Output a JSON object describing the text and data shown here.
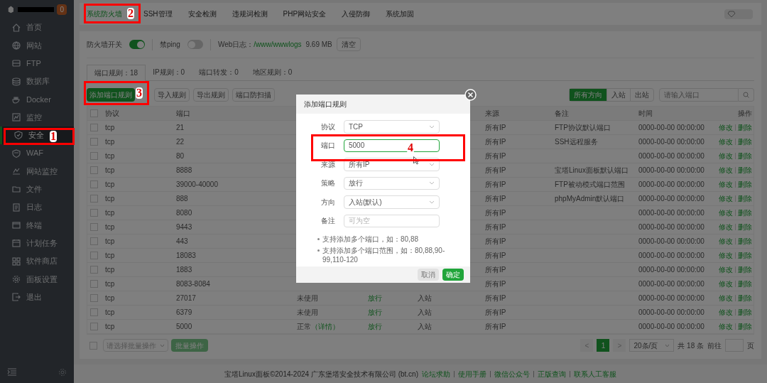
{
  "sidebar": {
    "badge": "0",
    "items": [
      {
        "label": "首页",
        "selected": false
      },
      {
        "label": "网站",
        "selected": false
      },
      {
        "label": "FTP",
        "selected": false
      },
      {
        "label": "数据库",
        "selected": false
      },
      {
        "label": "Docker",
        "selected": false
      },
      {
        "label": "监控",
        "selected": false
      },
      {
        "label": "安全",
        "selected": true
      },
      {
        "label": "WAF",
        "selected": false
      },
      {
        "label": "网站监控",
        "selected": false
      },
      {
        "label": "文件",
        "selected": false
      },
      {
        "label": "日志",
        "selected": false
      },
      {
        "label": "终端",
        "selected": false
      },
      {
        "label": "计划任务",
        "selected": false
      },
      {
        "label": "软件商店",
        "selected": false
      },
      {
        "label": "面板设置",
        "selected": false
      },
      {
        "label": "退出",
        "selected": false
      }
    ]
  },
  "top_tabs": [
    {
      "label": "系统防火墙",
      "selected": true
    },
    {
      "label": "SSH管理",
      "selected": false
    },
    {
      "label": "安全检测",
      "selected": false
    },
    {
      "label": "违规词检测",
      "selected": false
    },
    {
      "label": "PHP网站安全",
      "selected": false
    },
    {
      "label": "入侵防御",
      "selected": false
    },
    {
      "label": "系统加固",
      "selected": false
    }
  ],
  "firewall": {
    "switch": {
      "label": "防火墙开关",
      "on": true
    },
    "ping": {
      "label": "禁ping",
      "on": false
    },
    "web_log": {
      "label": "Web日志：",
      "path": "/www/wwwlogs",
      "size": "9.69 MB",
      "clear_button": "清空"
    }
  },
  "sub_tabs": [
    {
      "label": "端口规则：18",
      "selected": true
    },
    {
      "label": "IP规则：0",
      "selected": false
    },
    {
      "label": "端口转发：0",
      "selected": false
    },
    {
      "label": "地区规则：0",
      "selected": false
    }
  ],
  "actions": [
    {
      "label": "添加端口规则",
      "kind": "primary"
    },
    {
      "label": "导入规则",
      "kind": "default"
    },
    {
      "label": "导出规则",
      "kind": "default"
    },
    {
      "label": "端口防扫描",
      "kind": "default"
    }
  ],
  "direction_filter": [
    {
      "label": "所有方向",
      "selected": true
    },
    {
      "label": "入站",
      "selected": false
    },
    {
      "label": "出站",
      "selected": false
    }
  ],
  "search": {
    "placeholder": "请输入端口"
  },
  "table": {
    "select_all": {
      "checked": false
    },
    "columns": {
      "protocol": "协议",
      "port": "端口",
      "source": "来源",
      "remark": "备注",
      "time": "时间",
      "actions": "操作"
    },
    "rows": [
      {
        "checked": false,
        "protocol": "tcp",
        "port": "21",
        "source": "所有IP",
        "remark": "FTP协议默认端口",
        "time": "0000-00-00 00:00:00",
        "edit": "修改",
        "delete": "删除"
      },
      {
        "checked": false,
        "protocol": "tcp",
        "port": "22",
        "source": "所有IP",
        "remark": "SSH远程服务",
        "time": "0000-00-00 00:00:00",
        "edit": "修改",
        "delete": "删除"
      },
      {
        "checked": false,
        "protocol": "tcp",
        "port": "80",
        "source": "所有IP",
        "time": "0000-00-00 00:00:00",
        "edit": "修改",
        "delete": "删除"
      },
      {
        "checked": false,
        "protocol": "tcp",
        "port": "8888",
        "source": "所有IP",
        "remark": "宝塔Linux面板默认端口",
        "time": "0000-00-00 00:00:00",
        "edit": "修改",
        "delete": "删除"
      },
      {
        "checked": false,
        "protocol": "tcp",
        "port": "39000-40000",
        "source": "所有IP",
        "remark": "FTP被动模式端口范围",
        "time": "0000-00-00 00:00:00",
        "edit": "修改",
        "delete": "删除"
      },
      {
        "checked": false,
        "protocol": "tcp",
        "port": "888",
        "source": "所有IP",
        "remark": "phpMyAdmin默认端口",
        "time": "0000-00-00 00:00:00",
        "edit": "修改",
        "delete": "删除"
      },
      {
        "checked": false,
        "protocol": "tcp",
        "port": "8080",
        "source": "所有IP",
        "time": "0000-00-00 00:00:00",
        "edit": "修改",
        "delete": "删除"
      },
      {
        "checked": false,
        "protocol": "tcp",
        "port": "9443",
        "source": "所有IP",
        "time": "0000-00-00 00:00:00",
        "edit": "修改",
        "delete": "删除"
      },
      {
        "checked": false,
        "protocol": "tcp",
        "port": "443",
        "source": "所有IP",
        "time": "0000-00-00 00:00:00",
        "edit": "修改",
        "delete": "删除"
      },
      {
        "checked": false,
        "protocol": "tcp",
        "port": "18083",
        "source": "所有IP",
        "time": "0000-00-00 00:00:00",
        "edit": "修改",
        "delete": "删除"
      },
      {
        "checked": false,
        "protocol": "tcp",
        "port": "1883",
        "source": "所有IP",
        "time": "0000-00-00 00:00:00",
        "edit": "修改",
        "delete": "删除"
      },
      {
        "checked": false,
        "protocol": "tcp",
        "port": "8083-8084",
        "source": "所有IP",
        "time": "0000-00-00 00:00:00",
        "edit": "修改",
        "delete": "删除"
      },
      {
        "checked": false,
        "protocol": "tcp",
        "port": "27017",
        "status": "未使用",
        "strategy": "放行",
        "direction": "入站",
        "source": "所有IP",
        "time": "0000-00-00 00:00:00",
        "edit": "修改",
        "delete": "删除"
      },
      {
        "checked": false,
        "protocol": "tcp",
        "port": "6379",
        "status": "未使用",
        "strategy": "放行",
        "direction": "入站",
        "source": "所有IP",
        "time": "0000-00-00 00:00:00",
        "edit": "修改",
        "delete": "删除"
      },
      {
        "checked": false,
        "protocol": "tcp",
        "port": "5000",
        "status": "正常",
        "status_link": "（详情）",
        "strategy": "放行",
        "direction": "入站",
        "source": "所有IP",
        "time": "0000-00-00 00:00:00",
        "edit": "修改",
        "delete": "删除"
      }
    ]
  },
  "batch": {
    "checked": false,
    "select_placeholder": "请选择批量操作",
    "button": "批量操作"
  },
  "pagination": {
    "prev": "<",
    "pages": [
      {
        "label": "1",
        "selected": true
      }
    ],
    "next": ">",
    "page_size": "20条/页",
    "total": "共 18 条",
    "goto": "前往",
    "page_unit": "页"
  },
  "modal": {
    "title": "添加端口规则",
    "fields": [
      {
        "label": "协议",
        "kind": "select",
        "value": "TCP"
      },
      {
        "label": "端口",
        "kind": "input",
        "value": "5000",
        "focused": true
      },
      {
        "label": "来源",
        "kind": "select",
        "value": "所有IP"
      },
      {
        "label": "策略",
        "kind": "select",
        "value": "放行"
      },
      {
        "label": "方向",
        "kind": "select",
        "value": "入站(默认)"
      },
      {
        "label": "备注",
        "kind": "input",
        "placeholder": "可为空",
        "focused": false
      }
    ],
    "tips": [
      "支持添加多个端口，如：80,88",
      "支持添加多个端口范围，如：80,88,90-99,110-120"
    ],
    "cancel": {
      "label": "取消",
      "disabled": true
    },
    "confirm": "确定"
  },
  "footer": {
    "copyright": "宝塔Linux面板©2014-2024 广东堡塔安全技术有限公司 (bt.cn)",
    "links": [
      "论坛求助",
      "使用手册",
      "微信公众号",
      "正版查询",
      "联系人工客服"
    ]
  },
  "annotations": [
    "1",
    "2",
    "3",
    "4"
  ]
}
